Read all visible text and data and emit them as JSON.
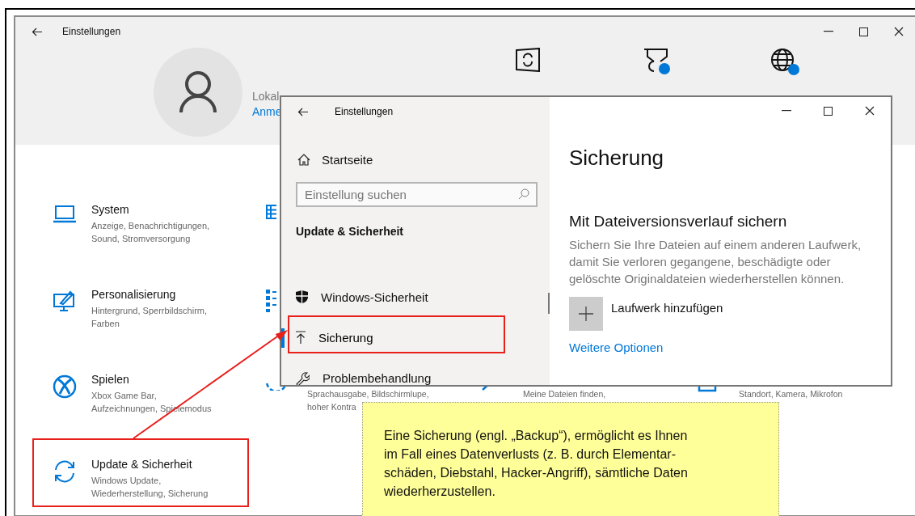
{
  "window": {
    "title": "Einstellungen"
  },
  "account": {
    "name": "Lokal",
    "link": "Anme"
  },
  "categories": [
    {
      "title": "System",
      "description": "Anzeige, Benachrichtigungen,\nSound, Stromversorgung"
    },
    {
      "title": "Personalisierung",
      "description": "Hintergrund, Sperrbildschirm,\nFarben"
    },
    {
      "title": "Spielen",
      "description": "Xbox Game Bar,\nAufzeichnungen, Spielemodus"
    },
    {
      "title": "Update & Sicherheit",
      "description": "Windows Update,\nWiederherstellung, Sicherung"
    }
  ],
  "partly_hidden_categories": [
    {
      "description": "Sprachausgabe, Bildschirmlupe,\nhoher Kontra"
    },
    {
      "description": "Meine Dateien finden,"
    },
    {
      "description": "Standort, Kamera, Mikrofon"
    }
  ],
  "dialog": {
    "title": "Einstellungen",
    "home": "Startseite",
    "search": {
      "placeholder": "Einstellung suchen"
    },
    "section": "Update & Sicherheit",
    "nav_items": [
      {
        "label": "Windows-Sicherheit",
        "selected": false
      },
      {
        "label": "Sicherung",
        "selected": true
      },
      {
        "label": "Problembehandlung",
        "selected": false
      }
    ],
    "page_title": "Sicherung",
    "heading": "Mit Dateiversionsverlauf sichern",
    "description": "Sichern Sie Ihre Dateien auf einem anderen Laufwerk, damit Sie verloren gegangene, beschädigte oder gelöschte Originaldateien wiederherstellen können.",
    "add_drive": "Laufwerk hinzufügen",
    "more_options": "Weitere Optionen"
  },
  "note": {
    "text": "Eine Sicherung (engl. „Backup“), ermöglicht es Ihnen\nim Fall eines Datenverlusts (z. B. durch Elementar-\nschäden, Diebstahl, Hacker-Angriff), sämtliche Daten\nwiederherzustellen."
  }
}
